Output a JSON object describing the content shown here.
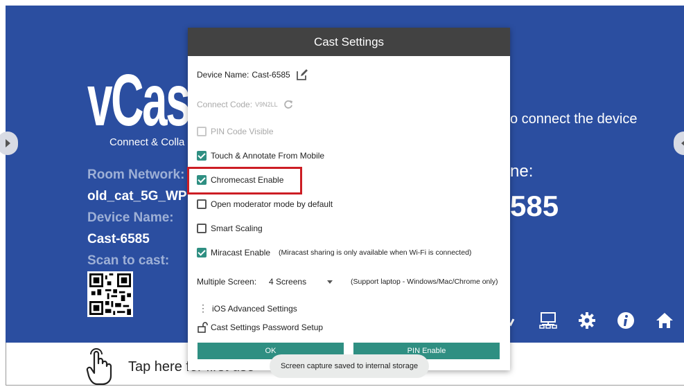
{
  "background": {
    "logo_text": "vCas",
    "tagline": "Connect & Colla",
    "room_network_label": "Room Network:",
    "room_network_value": "old_cat_5G_WP",
    "device_name_label": "Device Name:",
    "device_name_value": "Cast-6585",
    "scan_label": "Scan to cast:",
    "right_instruction": "o connect the device",
    "right_label": "ne:",
    "right_big": "585",
    "tap_text": "Tap here for first use",
    "toolbar_icons": [
      "checkmark-icon",
      "network-icon",
      "gear-icon",
      "info-icon",
      "home-icon"
    ]
  },
  "dialog": {
    "title": "Cast Settings",
    "device_name_label": "Device Name:",
    "device_name_value": "Cast-6585",
    "connect_code_label": "Connect Code:",
    "connect_code_value": "V9N2LL",
    "options": [
      {
        "label": "PIN Code Visible",
        "checked": false,
        "disabled": true
      },
      {
        "label": "Touch & Annotate From Mobile",
        "checked": true,
        "disabled": false
      },
      {
        "label": "Chromecast Enable",
        "checked": true,
        "disabled": false
      },
      {
        "label": "Open moderator mode by default",
        "checked": false,
        "disabled": false
      },
      {
        "label": "Smart Scaling",
        "checked": false,
        "disabled": false
      },
      {
        "label": "Miracast Enable",
        "checked": true,
        "disabled": false
      }
    ],
    "miracast_note": "(Miracast sharing is only available when Wi-Fi is connected)",
    "multiple_screen_label": "Multiple Screen:",
    "multiple_screen_value": "4 Screens",
    "multiple_screen_note": "(Support laptop - Windows/Mac/Chrome only)",
    "ios_advanced": "iOS Advanced Settings",
    "password_setup": "Cast Settings Password Setup",
    "ok_button": "OK",
    "pin_enable_button": "PIN Enable"
  },
  "toast": "Screen capture saved to internal storage",
  "colors": {
    "background_blue": "#2b4ea0",
    "accent_teal": "#2f8f82",
    "header_dark": "#424242",
    "highlight_red": "#cc1d24"
  }
}
